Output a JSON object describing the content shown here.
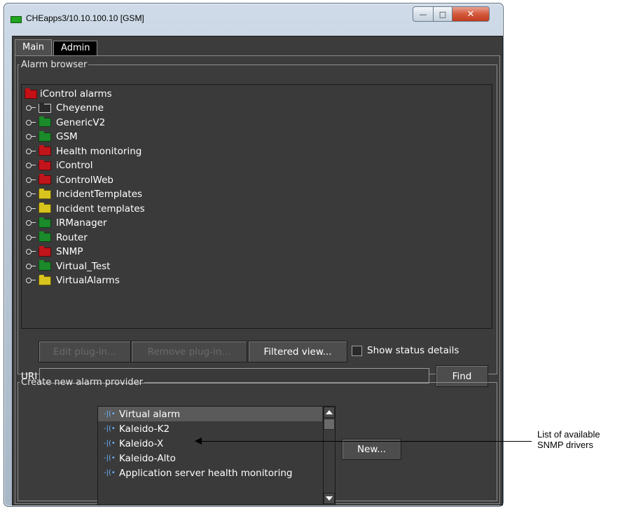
{
  "window": {
    "title": "CHEapps3/10.10.100.10 [GSM]",
    "minimize_glyph": "—",
    "maximize_glyph": "□",
    "close_glyph": "✕"
  },
  "tabs": [
    {
      "label": "Main",
      "active": true
    },
    {
      "label": "Admin",
      "active": false
    }
  ],
  "alarm_browser": {
    "legend": "Alarm browser",
    "root": "iControl alarms",
    "items": [
      {
        "label": "Cheyenne",
        "folder_color": "gray"
      },
      {
        "label": "GenericV2",
        "folder_color": "green"
      },
      {
        "label": "GSM",
        "folder_color": "green"
      },
      {
        "label": "Health monitoring",
        "folder_color": "red"
      },
      {
        "label": "iControl",
        "folder_color": "red"
      },
      {
        "label": "iControlWeb",
        "folder_color": "red"
      },
      {
        "label": "IncidentTemplates",
        "folder_color": "yellow"
      },
      {
        "label": "Incident templates",
        "folder_color": "yellow"
      },
      {
        "label": "IRManager",
        "folder_color": "green"
      },
      {
        "label": "Router",
        "folder_color": "green"
      },
      {
        "label": "SNMP",
        "folder_color": "red"
      },
      {
        "label": "Virtual_Test",
        "folder_color": "green"
      },
      {
        "label": "VirtualAlarms",
        "folder_color": "yellow"
      }
    ],
    "buttons": {
      "edit_plugin": "Edit plug-in...",
      "remove_plugin": "Remove plug-in...",
      "filtered_view": "Filtered view..."
    },
    "show_status_details": {
      "label": "Show status details",
      "checked": false
    },
    "uri": {
      "label": "URI",
      "value": ""
    },
    "find_button": "Find"
  },
  "create_provider": {
    "legend": "Create new alarm provider",
    "items": [
      {
        "label": "Virtual alarm",
        "selected": true
      },
      {
        "label": "Kaleido-K2",
        "selected": false
      },
      {
        "label": "Kaleido-X",
        "selected": false
      },
      {
        "label": "Kaleido-Alto",
        "selected": false
      },
      {
        "label": "Application server health monitoring",
        "selected": false
      }
    ],
    "new_button": "New..."
  },
  "annotation": {
    "line1": "List of available",
    "line2": "SNMP drivers"
  },
  "colors": {
    "panel_bg": "#3c3c3c",
    "folder_green": "#1b8a2a",
    "folder_red": "#c2151b",
    "folder_yellow": "#d8c41e",
    "driver_icon": "#6cb4ff"
  }
}
